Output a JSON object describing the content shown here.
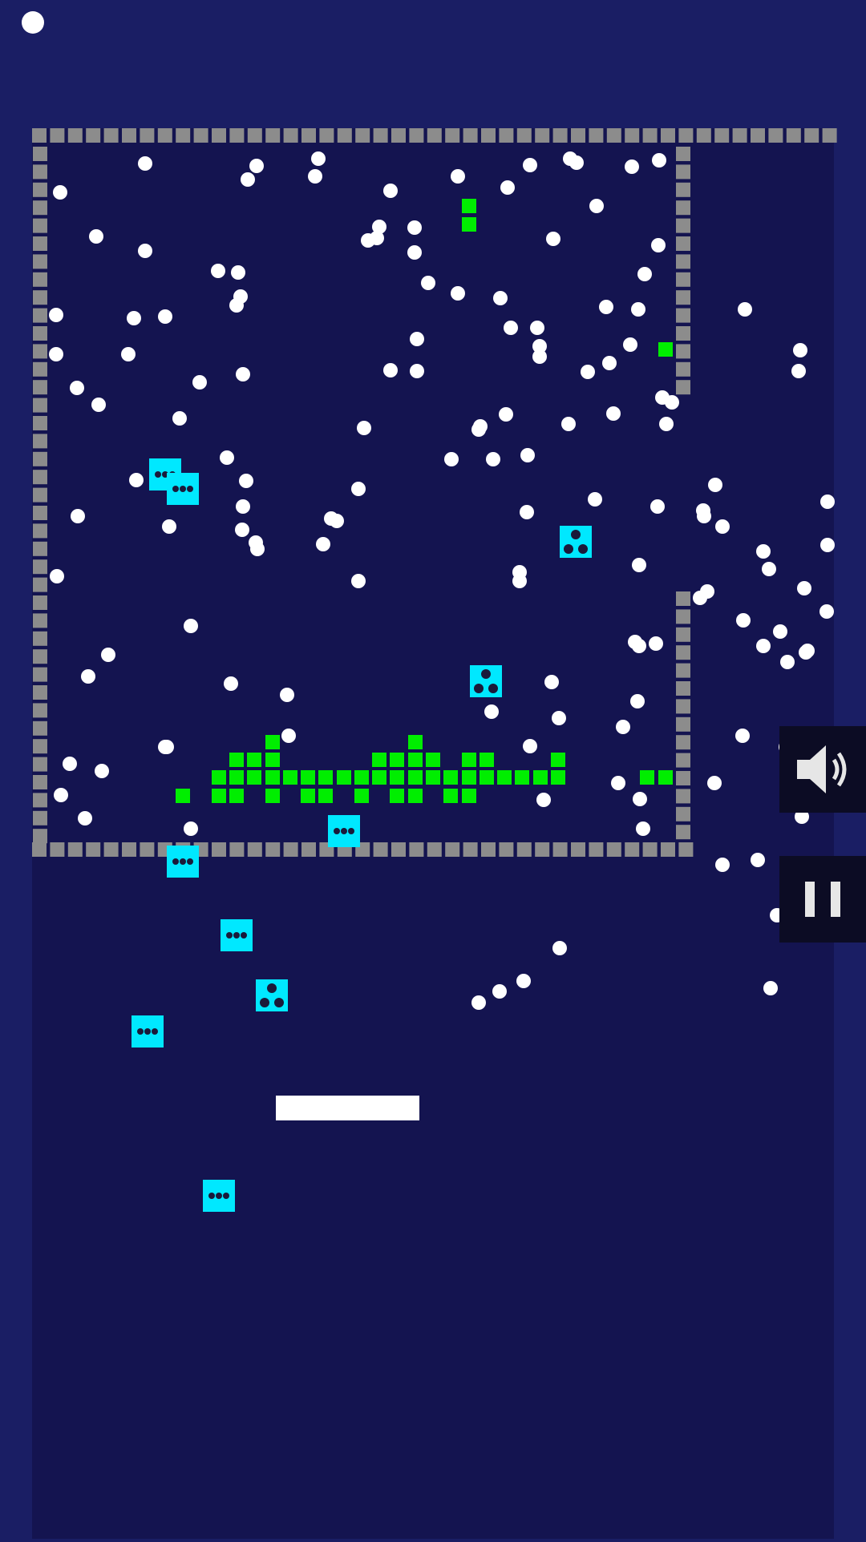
{
  "game": {
    "lives": 1,
    "colors": {
      "background": "#1a1e64",
      "playfield": "#141450",
      "wall": "#8c8c8c",
      "brick": "#00ee00",
      "ball": "#ffffff",
      "powerup": "#00e8ff",
      "paddle": "#ffffff",
      "button_bg": "#0c0c24"
    },
    "controls": [
      {
        "name": "sound",
        "icon": "speaker-icon",
        "state": "on"
      },
      {
        "name": "pause",
        "icon": "pause-icon"
      }
    ],
    "powerup_kinds": [
      "multi-ball-row",
      "multi-ball-triangle"
    ]
  }
}
